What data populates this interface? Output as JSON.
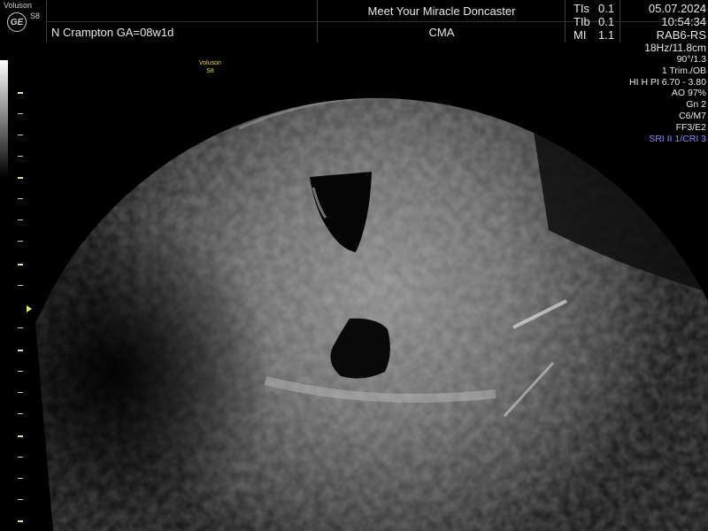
{
  "header": {
    "brand": "Voluson",
    "model": "S8",
    "logo": "GE",
    "patient_line": "N Crampton   GA=08w1d",
    "clinic": "Meet Your Miracle Doncaster",
    "protocol": "CMA",
    "indices": [
      {
        "label": "TIs",
        "value": "0.1"
      },
      {
        "label": "TIb",
        "value": "0.1"
      },
      {
        "label": "MI",
        "value": "1.1"
      }
    ],
    "date": "05.07.2024",
    "time": "10:54:34",
    "probe": "RAB6-RS"
  },
  "params": [
    "18Hz/11.8cm",
    "90°/1.3",
    "1 Trim./OB",
    "HI H PI 6.70 - 3.80",
    "AO 97%",
    "Gn  2",
    "C6/M7",
    "FF3/E2",
    "SRI II 1/CRI 3"
  ],
  "probe_mark": {
    "brand": "Voluson",
    "model": "S8"
  },
  "colors": {
    "accent_marker": "#e8d84a",
    "sri": "#8a88ff",
    "background": "#000000"
  }
}
